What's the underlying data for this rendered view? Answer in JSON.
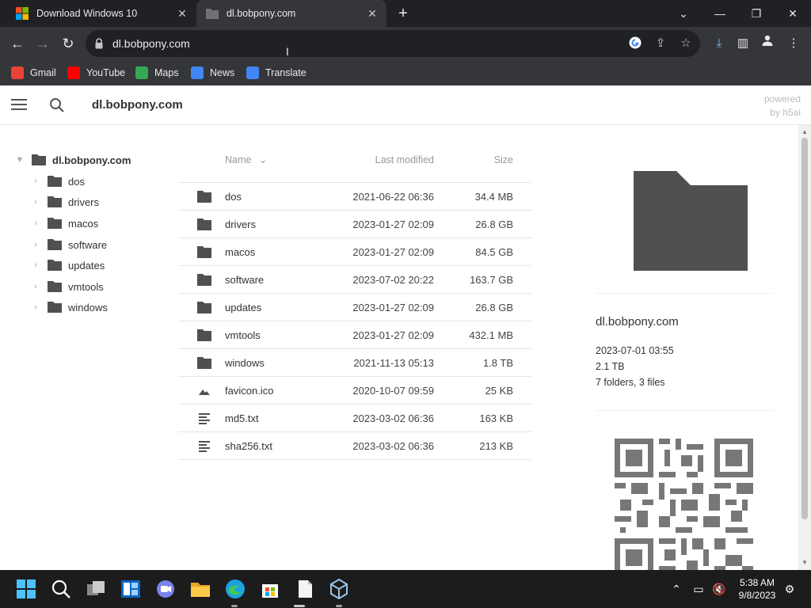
{
  "browser": {
    "tabs": [
      {
        "title": "Download Windows 10",
        "active": false
      },
      {
        "title": "dl.bobpony.com",
        "active": true
      }
    ],
    "address": "dl.bobpony.com",
    "bookmarks": [
      {
        "label": "Gmail",
        "icon": "gmail-icon",
        "color": "#ea4335"
      },
      {
        "label": "YouTube",
        "icon": "youtube-icon",
        "color": "#ff0000"
      },
      {
        "label": "Maps",
        "icon": "maps-icon",
        "color": "#34a853"
      },
      {
        "label": "News",
        "icon": "news-icon",
        "color": "#4285f4"
      },
      {
        "label": "Translate",
        "icon": "translate-icon",
        "color": "#4285f4"
      }
    ]
  },
  "page": {
    "crumb": "dl.bobpony.com",
    "powered_line1": "powered",
    "powered_line2": "by h5ai"
  },
  "tree": {
    "root": "dl.bobpony.com",
    "items": [
      "dos",
      "drivers",
      "macos",
      "software",
      "updates",
      "vmtools",
      "windows"
    ]
  },
  "listing": {
    "headers": {
      "name": "Name",
      "modified": "Last modified",
      "size": "Size"
    },
    "rows": [
      {
        "name": "dos",
        "type": "folder",
        "modified": "2021-06-22 06:36",
        "size": "34.4 MB"
      },
      {
        "name": "drivers",
        "type": "folder",
        "modified": "2023-01-27 02:09",
        "size": "26.8 GB"
      },
      {
        "name": "macos",
        "type": "folder",
        "modified": "2023-01-27 02:09",
        "size": "84.5 GB"
      },
      {
        "name": "software",
        "type": "folder",
        "modified": "2023-07-02 20:22",
        "size": "163.7 GB"
      },
      {
        "name": "updates",
        "type": "folder",
        "modified": "2023-01-27 02:09",
        "size": "26.8 GB"
      },
      {
        "name": "vmtools",
        "type": "folder",
        "modified": "2023-01-27 02:09",
        "size": "432.1 MB"
      },
      {
        "name": "windows",
        "type": "folder",
        "modified": "2021-11-13 05:13",
        "size": "1.8 TB"
      },
      {
        "name": "favicon.ico",
        "type": "image",
        "modified": "2020-10-07 09:59",
        "size": "25 KB"
      },
      {
        "name": "md5.txt",
        "type": "text",
        "modified": "2023-03-02 06:36",
        "size": "163 KB"
      },
      {
        "name": "sha256.txt",
        "type": "text",
        "modified": "2023-03-02 06:36",
        "size": "213 KB"
      }
    ]
  },
  "info": {
    "title": "dl.bobpony.com",
    "modified": "2023-07-01 03:55",
    "size": "2.1 TB",
    "counts": "7 folders, 3 files"
  },
  "taskbar": {
    "time": "5:38 AM",
    "date": "9/8/2023"
  },
  "colors": {
    "chrome_dark": "#202124",
    "chrome_toolbar": "#35363a",
    "folder_gray": "#505050",
    "taskbar": "#1c1c1c"
  }
}
